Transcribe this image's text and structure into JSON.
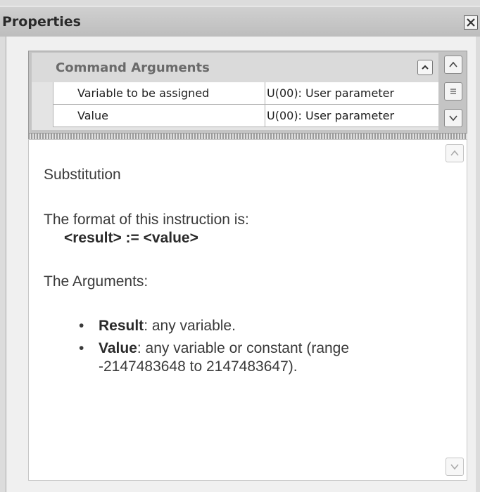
{
  "window": {
    "title": "Properties",
    "close_icon": "close-icon"
  },
  "property_grid": {
    "category": {
      "label": "Command Arguments",
      "collapse_icon": "chevron-up-icon"
    },
    "rows": [
      {
        "name": "Variable to be assigned",
        "value": "U(00): User parameter"
      },
      {
        "name": "Value",
        "value": "U(00): User parameter"
      }
    ],
    "scrollbar": {
      "up_icon": "chevron-up-icon",
      "thumb_icon": "grip-icon",
      "down_icon": "chevron-down-icon"
    }
  },
  "help": {
    "title": "Substitution",
    "format_intro": "The format of this instruction is:",
    "syntax": "<result> := <value>",
    "args_heading": "The Arguments:",
    "arguments": [
      {
        "name": "Result",
        "description": ": any variable."
      },
      {
        "name": "Value",
        "description": ": any variable or constant (range -2147483648 to 2147483647)."
      }
    ],
    "scrollbar": {
      "up_icon": "chevron-up-icon",
      "down_icon": "chevron-down-icon"
    }
  },
  "colors": {
    "panel_background": "#dcdcdc",
    "help_background": "#ffffff",
    "category_text": "#6a6a6a"
  }
}
